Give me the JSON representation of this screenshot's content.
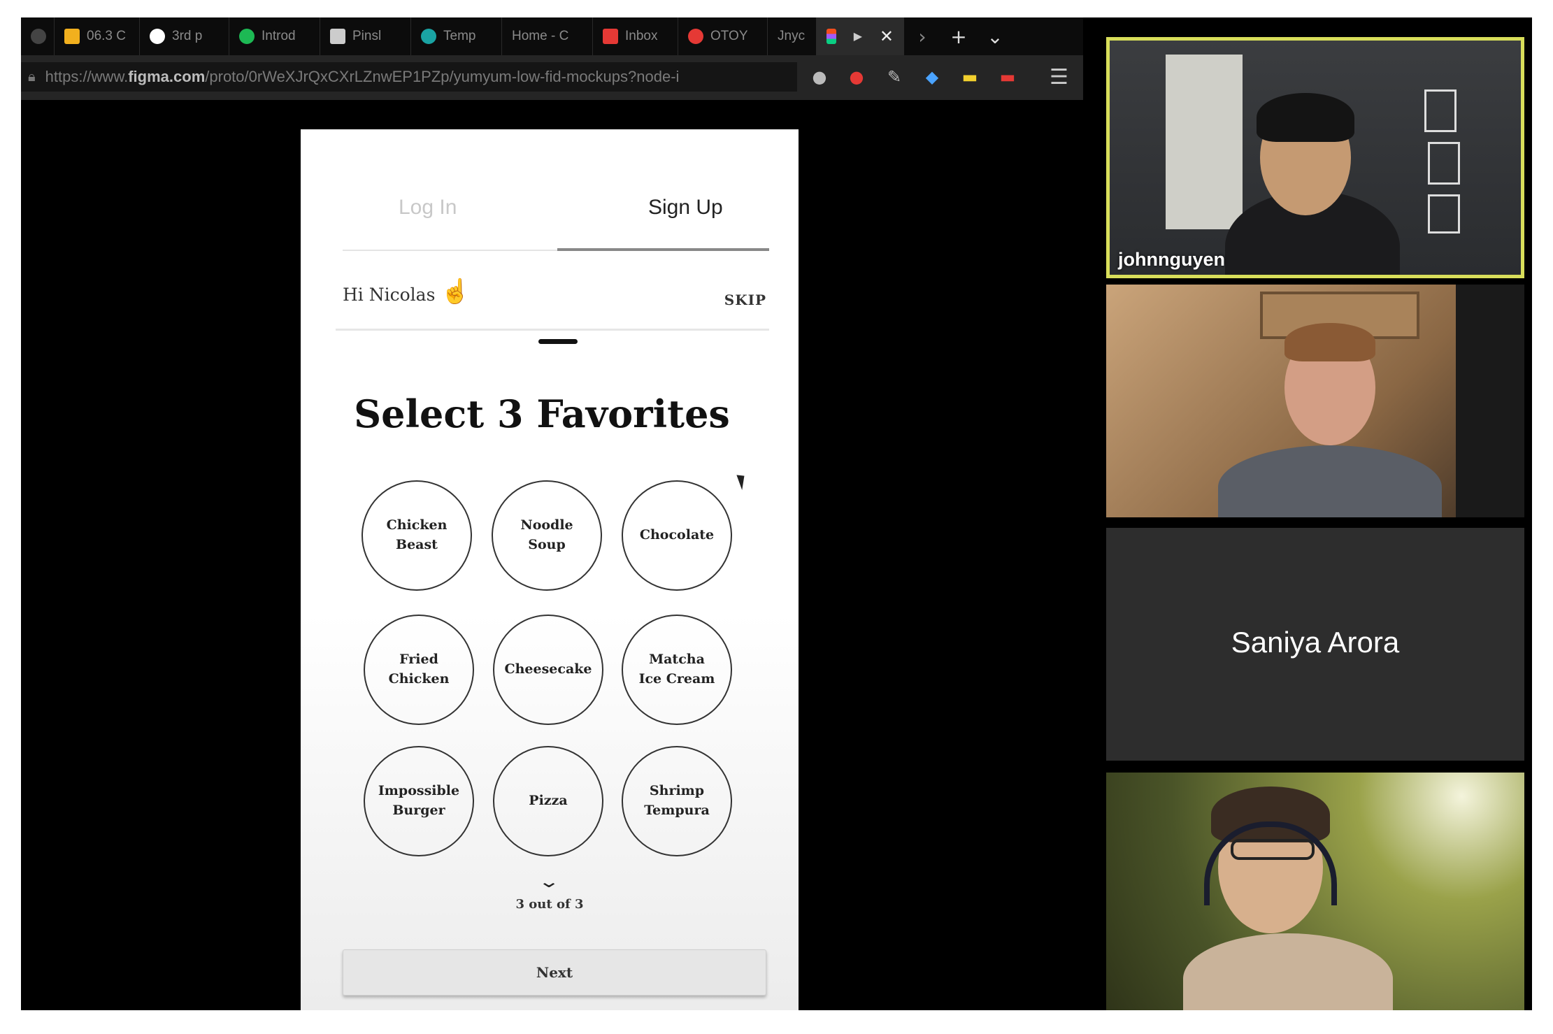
{
  "browser": {
    "tabs": [
      {
        "label": "",
        "color": "#555555"
      },
      {
        "label": "06.3 C",
        "color": "#f2b01e"
      },
      {
        "label": "3rd p",
        "color": "#ffffff"
      },
      {
        "label": "Introd",
        "color": "#1db954"
      },
      {
        "label": "Pinsl",
        "color": "#cccccc"
      },
      {
        "label": "Temp",
        "color": "#1aa3a3"
      },
      {
        "label": "Home - C",
        "color": ""
      },
      {
        "label": "Inbox",
        "color": "#e53935"
      },
      {
        "label": "OTOY",
        "color": "#e53935"
      },
      {
        "label": "Jnyc",
        "color": "#555555"
      }
    ],
    "url_prefix": "https://www.",
    "url_domain": "figma.com",
    "url_path": "/proto/0rWeXJrQxCXrLZnwEP1PZp/yumyum-low-fid-mockups?node-i"
  },
  "prototype": {
    "tab_login": "Log In",
    "tab_signup": "Sign Up",
    "greeting": "Hi Nicolas",
    "hand_glyph": "☝",
    "skip": "SKIP",
    "heading": "Select 3 Favorites",
    "foods": [
      {
        "line1": "Chicken",
        "line2": "Beast"
      },
      {
        "line1": "Noodle",
        "line2": "Soup"
      },
      {
        "line1": "Chocolate",
        "line2": ""
      },
      {
        "line1": "Fried",
        "line2": "Chicken"
      },
      {
        "line1": "Cheesecake",
        "line2": ""
      },
      {
        "line1": "Matcha",
        "line2": "Ice Cream"
      },
      {
        "line1": "Impossible",
        "line2": "Burger"
      },
      {
        "line1": "Pizza",
        "line2": ""
      },
      {
        "line1": "Shrimp",
        "line2": "Tempura"
      }
    ],
    "chevron": "⌄",
    "counter": "3 out of 3",
    "next": "Next"
  },
  "participants": [
    {
      "name": "johnnguyen",
      "active_speaker": true
    },
    {
      "name": ""
    },
    {
      "name": "Saniya Arora",
      "video_off": true
    },
    {
      "name": ""
    }
  ],
  "colors": {
    "active_speaker_border": "#d8de5a",
    "tab_bar": "#0c0c0c"
  }
}
